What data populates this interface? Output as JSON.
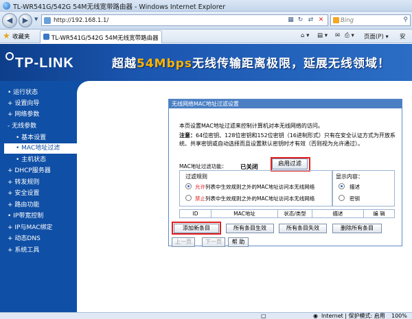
{
  "window": {
    "title": "TL-WR541G/542G 54M无线宽带路由器 - Windows Internet Explorer"
  },
  "addressbar": {
    "url": "http://192.168.1.1/",
    "search_placeholder": "Bing"
  },
  "favbar": {
    "favorites_label": "收藏夹",
    "tab_label": "TL-WR541G/542G 54M无线宽带路由器",
    "tools": {
      "page": "页面(P) ▾"
    }
  },
  "banner": {
    "logo": "TP-LINK",
    "slogan_pre": "超越",
    "slogan_highlight": "54Mbps",
    "slogan_rest": "无线传输距离极限，延展无线领域！"
  },
  "sidebar": {
    "items": [
      {
        "label": "• 运行状态"
      },
      {
        "label": "+ 设置向导"
      },
      {
        "label": "+ 网络参数"
      },
      {
        "label": "- 无线参数"
      },
      {
        "label": "• 基本设置"
      },
      {
        "label": "• MAC地址过滤"
      },
      {
        "label": "• 主机状态"
      },
      {
        "label": "+ DHCP服务器"
      },
      {
        "label": "+ 转发规则"
      },
      {
        "label": "+ 安全设置"
      },
      {
        "label": "+ 路由功能"
      },
      {
        "label": "• IP带宽控制"
      },
      {
        "label": "+ IP与MAC绑定"
      },
      {
        "label": "+ 动态DNS"
      },
      {
        "label": "+ 系统工具"
      }
    ]
  },
  "panel": {
    "title": "无线网络MAC地址过滤设置",
    "description": "本页设置MAC地址过滤来控制计算机对本无线网络的访问。",
    "note_label": "注意：",
    "note_text": "64位密钥、128位密钥和152位密钥（16进制形式）只有在安全认证方式为开放系统、共享密钥或自动选择而且设置默认密钥时才有效（否则视为允许通过）。",
    "status_label": "MAC地址过滤功能：",
    "status_value": "已关闭",
    "enable_button": "启用过滤",
    "rules": {
      "title": "过滤规则",
      "allow_hl": "允许",
      "allow_rest": "列表中生效规则之外的MAC地址访问本无线网络",
      "deny_hl": "禁止",
      "deny_rest": "列表中生效规则之外的MAC地址访问本无线网络"
    },
    "show": {
      "title": "显示内容：",
      "opt_desc": "描述",
      "opt_key": "密钥"
    },
    "table_headers": [
      "ID",
      "MAC地址",
      "状态/类型",
      "描述",
      "编 辑"
    ],
    "buttons": {
      "add": "添加新条目",
      "all_enable": "所有条目生效",
      "all_disable": "所有条目失效",
      "delete_all": "删除所有条目",
      "prev": "上一页",
      "next": "下一页",
      "help": "帮 助"
    }
  },
  "statusbar": {
    "zone": "Internet | 保护模式: 启用",
    "zoom": "100%"
  }
}
